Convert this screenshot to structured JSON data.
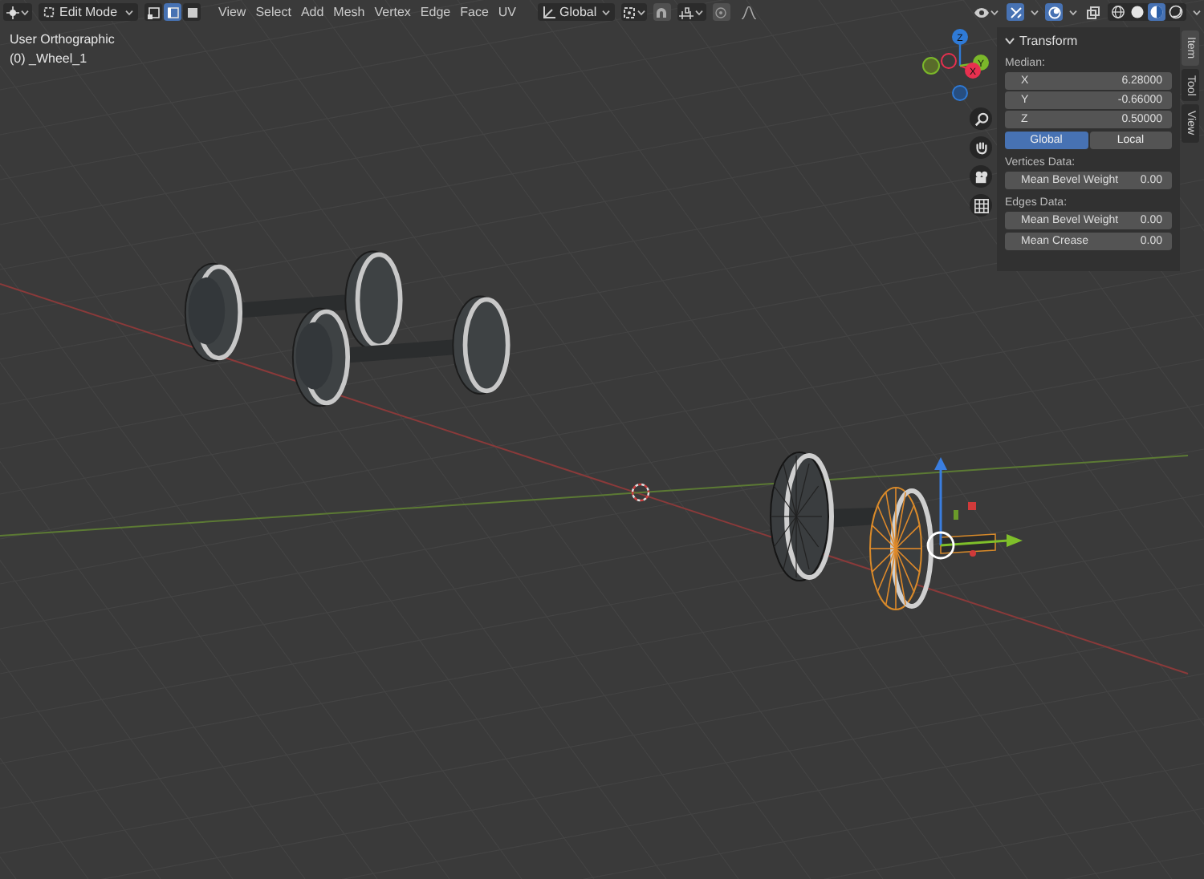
{
  "toolbar": {
    "mode": "Edit Mode",
    "select_modes": [
      {
        "kind": "vertex",
        "selected": false
      },
      {
        "kind": "edge",
        "selected": true
      },
      {
        "kind": "face",
        "selected": false
      }
    ],
    "menus": [
      "View",
      "Select",
      "Add",
      "Mesh",
      "Vertex",
      "Edge",
      "Face",
      "UV"
    ],
    "orientation": "Global",
    "shading": [
      {
        "kind": "wireframe",
        "selected": false
      },
      {
        "kind": "solid",
        "selected": false
      },
      {
        "kind": "material",
        "selected": true
      },
      {
        "kind": "rendered",
        "selected": false
      }
    ]
  },
  "overlay": {
    "view": "User Orthographic",
    "object": "(0) _Wheel_1"
  },
  "gizmo": {
    "axes": [
      {
        "label": "Z",
        "color": "#2f7ad6"
      },
      {
        "label": "X",
        "color": "#e8304f"
      },
      {
        "label": "Y",
        "color": "#7bb82a"
      }
    ]
  },
  "sidebar": {
    "tabs": [
      {
        "label": "Item",
        "selected": true
      },
      {
        "label": "Tool",
        "selected": false
      },
      {
        "label": "View",
        "selected": false
      }
    ],
    "panel": {
      "title": "Transform",
      "expanded": true,
      "median_label": "Median:",
      "fields": [
        {
          "label": "X",
          "value": "6.28000"
        },
        {
          "label": "Y",
          "value": "-0.66000"
        },
        {
          "label": "Z",
          "value": "0.50000"
        }
      ],
      "space": [
        {
          "label": "Global",
          "selected": true
        },
        {
          "label": "Local",
          "selected": false
        }
      ],
      "vertices_label": "Vertices Data:",
      "vertices_fields": [
        {
          "label": "Mean Bevel Weight",
          "value": "0.00"
        }
      ],
      "edges_label": "Edges Data:",
      "edges_fields": [
        {
          "label": "Mean Bevel Weight",
          "value": "0.00"
        },
        {
          "label": "Mean Crease",
          "value": "0.00"
        }
      ]
    }
  }
}
